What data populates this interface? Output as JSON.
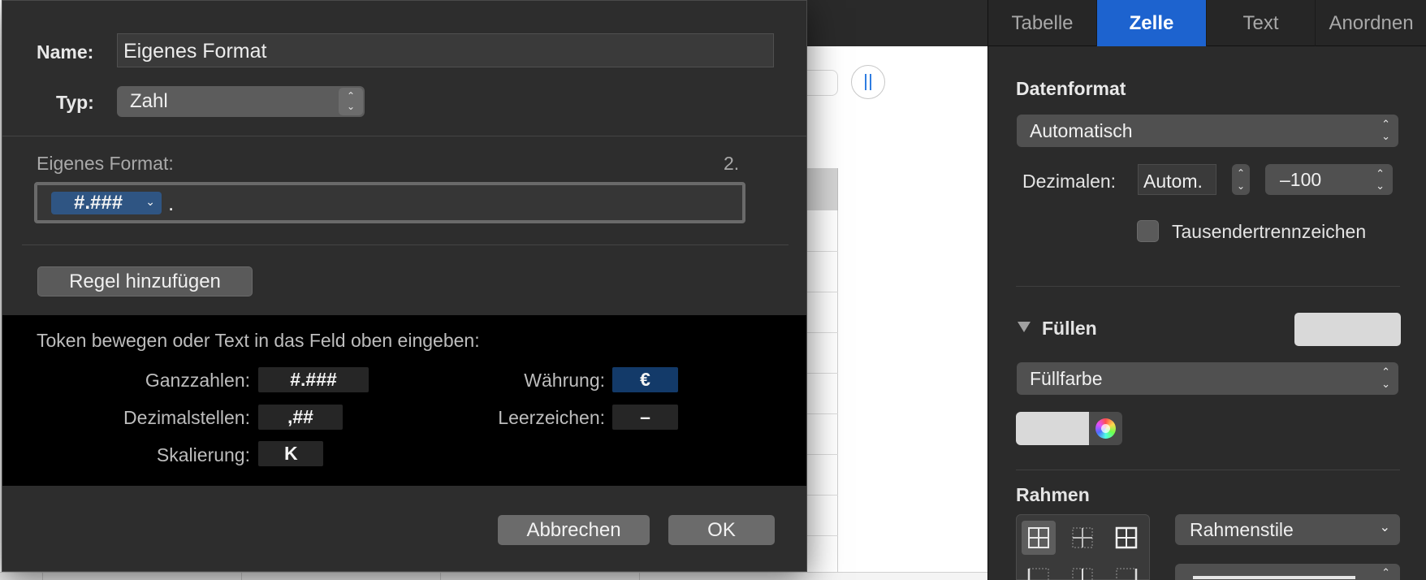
{
  "dialog": {
    "name_label": "Name:",
    "name_value": "Eigenes Format",
    "type_label": "Typ:",
    "type_value": "Zahl",
    "custom_format_label": "Eigenes Format:",
    "rule_number": "2.",
    "format_token": "#.###",
    "format_trailing_text": ".",
    "add_rule_button": "Regel hinzufügen",
    "token_hint": "Token bewegen oder Text in das Feld oben eingeben:",
    "tokens": {
      "integers_label": "Ganzzahlen:",
      "integers_token": "#.###",
      "decimals_label": "Dezimalstellen:",
      "decimals_token": ",##",
      "scale_label": "Skalierung:",
      "scale_token": "K",
      "currency_label": "Währung:",
      "currency_token": "€",
      "space_label": "Leerzeichen:",
      "space_token": "–"
    },
    "cancel_button": "Abbrechen",
    "ok_button": "OK"
  },
  "inspector": {
    "tabs": [
      "Tabelle",
      "Zelle",
      "Text",
      "Anordnen"
    ],
    "active_tab": "Zelle",
    "data_format_title": "Datenformat",
    "data_format_value": "Automatisch",
    "decimals_label": "Dezimalen:",
    "decimals_value": "Autom.",
    "negative_format": "–100",
    "thousands_separator_label": "Tausendertrennzeichen",
    "fill_title": "Füllen",
    "fill_type": "Füllfarbe",
    "border_title": "Rahmen",
    "border_style": "Rahmenstile"
  },
  "colors": {
    "accent": "#1d63cf",
    "token_highlight": "#133a69",
    "token_chip": "#2f5583",
    "fill_swatch": "#d9d9d9"
  }
}
